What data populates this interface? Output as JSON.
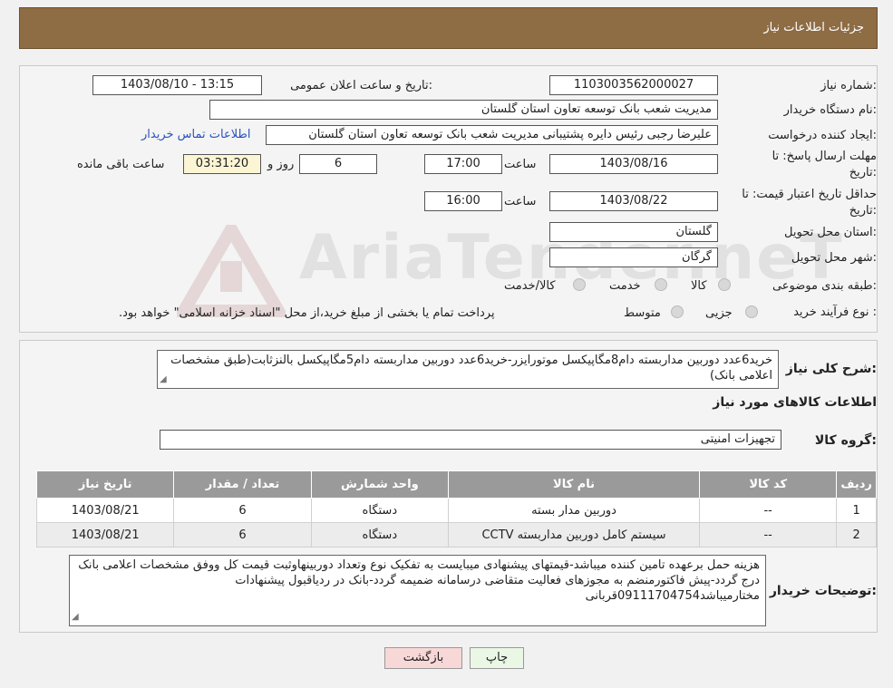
{
  "header": {
    "title": "جزئیات اطلاعات نیاز"
  },
  "fields": {
    "need_number_label": "شماره نیاز:",
    "need_number": "1103003562000027",
    "announce_label": "تاریخ و ساعت اعلان عمومی:",
    "announce_value": "1403/08/10 - 13:15",
    "buyer_org_label": "نام دستگاه خریدار:",
    "buyer_org": "مدیریت شعب بانک توسعه تعاون استان گلستان",
    "requester_label": "ایجاد کننده درخواست:",
    "requester": "علیرضا رجبی رئیس دایره پشتیبانی مدیریت شعب بانک توسعه تعاون استان گلستان",
    "contact_link": "اطلاعات تماس خریدار",
    "deadline_label_1": "مهلت ارسال پاسخ: تا",
    "deadline_label_2": "تاریخ:",
    "deadline_date": "1403/08/16",
    "time_label": "ساعت",
    "deadline_time": "17:00",
    "days_value": "6",
    "days_label": "روز و",
    "remaining_value": "03:31:20",
    "remaining_label": "ساعت باقی مانده",
    "validity_label_1": "حداقل تاریخ اعتبار قیمت: تا",
    "validity_label_2": "تاریخ:",
    "validity_date": "1403/08/22",
    "validity_time": "16:00",
    "province_label": "استان محل تحویل:",
    "province": "گلستان",
    "city_label": "شهر محل تحویل:",
    "city": "گرگان",
    "category_label": "طبقه بندی موضوعی:",
    "category_options": [
      "کالا",
      "خدمت",
      "کالا/خدمت"
    ],
    "process_label": "نوع فرآیند خرید :",
    "process_options": [
      "جزیی",
      "متوسط"
    ],
    "process_note": "پرداخت تمام یا بخشی از مبلغ خرید،از محل \"اسناد خزانه اسلامی\" خواهد بود."
  },
  "description": {
    "label": "شرح کلی نیاز:",
    "text": "خرید6عدد دوربین مداربسته دام8مگاپیکسل موتورایزر-خرید6عدد دوربین مداربسته دام5مگاپیکسل بالنزثابت(طبق مشخصات اعلامی بانک)"
  },
  "goods": {
    "section_title": "اطلاعات کالاهای مورد نیاز",
    "group_label": "گروه کالا:",
    "group_value": "تجهیزات امنیتی",
    "columns": [
      "ردیف",
      "کد کالا",
      "نام کالا",
      "واحد شمارش",
      "تعداد / مقدار",
      "تاریخ نیاز"
    ],
    "rows": [
      [
        "1",
        "--",
        "دوربین مدار بسته",
        "دستگاه",
        "6",
        "1403/08/21"
      ],
      [
        "2",
        "--",
        "سیستم کامل دوربین مداربسته CCTV",
        "دستگاه",
        "6",
        "1403/08/21"
      ]
    ]
  },
  "buyer_notes": {
    "label": "توضیحات خریدار:",
    "text": "هزینه حمل برعهده تامین کننده میباشد-قیمتهای پیشنهادی میبایست به تفکیک نوع وتعداد دوربینهاوثبت قیمت کل ووفق مشخصات اعلامی بانک درج گردد-پیش فاکتورمنضم به مجوزهای فعالیت متقاضی درسامانه ضمیمه گردد-بانک در ردیاقبول پیشنهادات مختارمیباشد09111704754قربانی"
  },
  "buttons": {
    "print": "چاپ",
    "back": "بازگشت"
  },
  "watermark": "AriaTender.neT",
  "colors": {
    "header_bg": "#8e6c44",
    "link": "#2a52be",
    "back_btn": "#f8d7d7",
    "print_btn": "#eaf7e4"
  }
}
